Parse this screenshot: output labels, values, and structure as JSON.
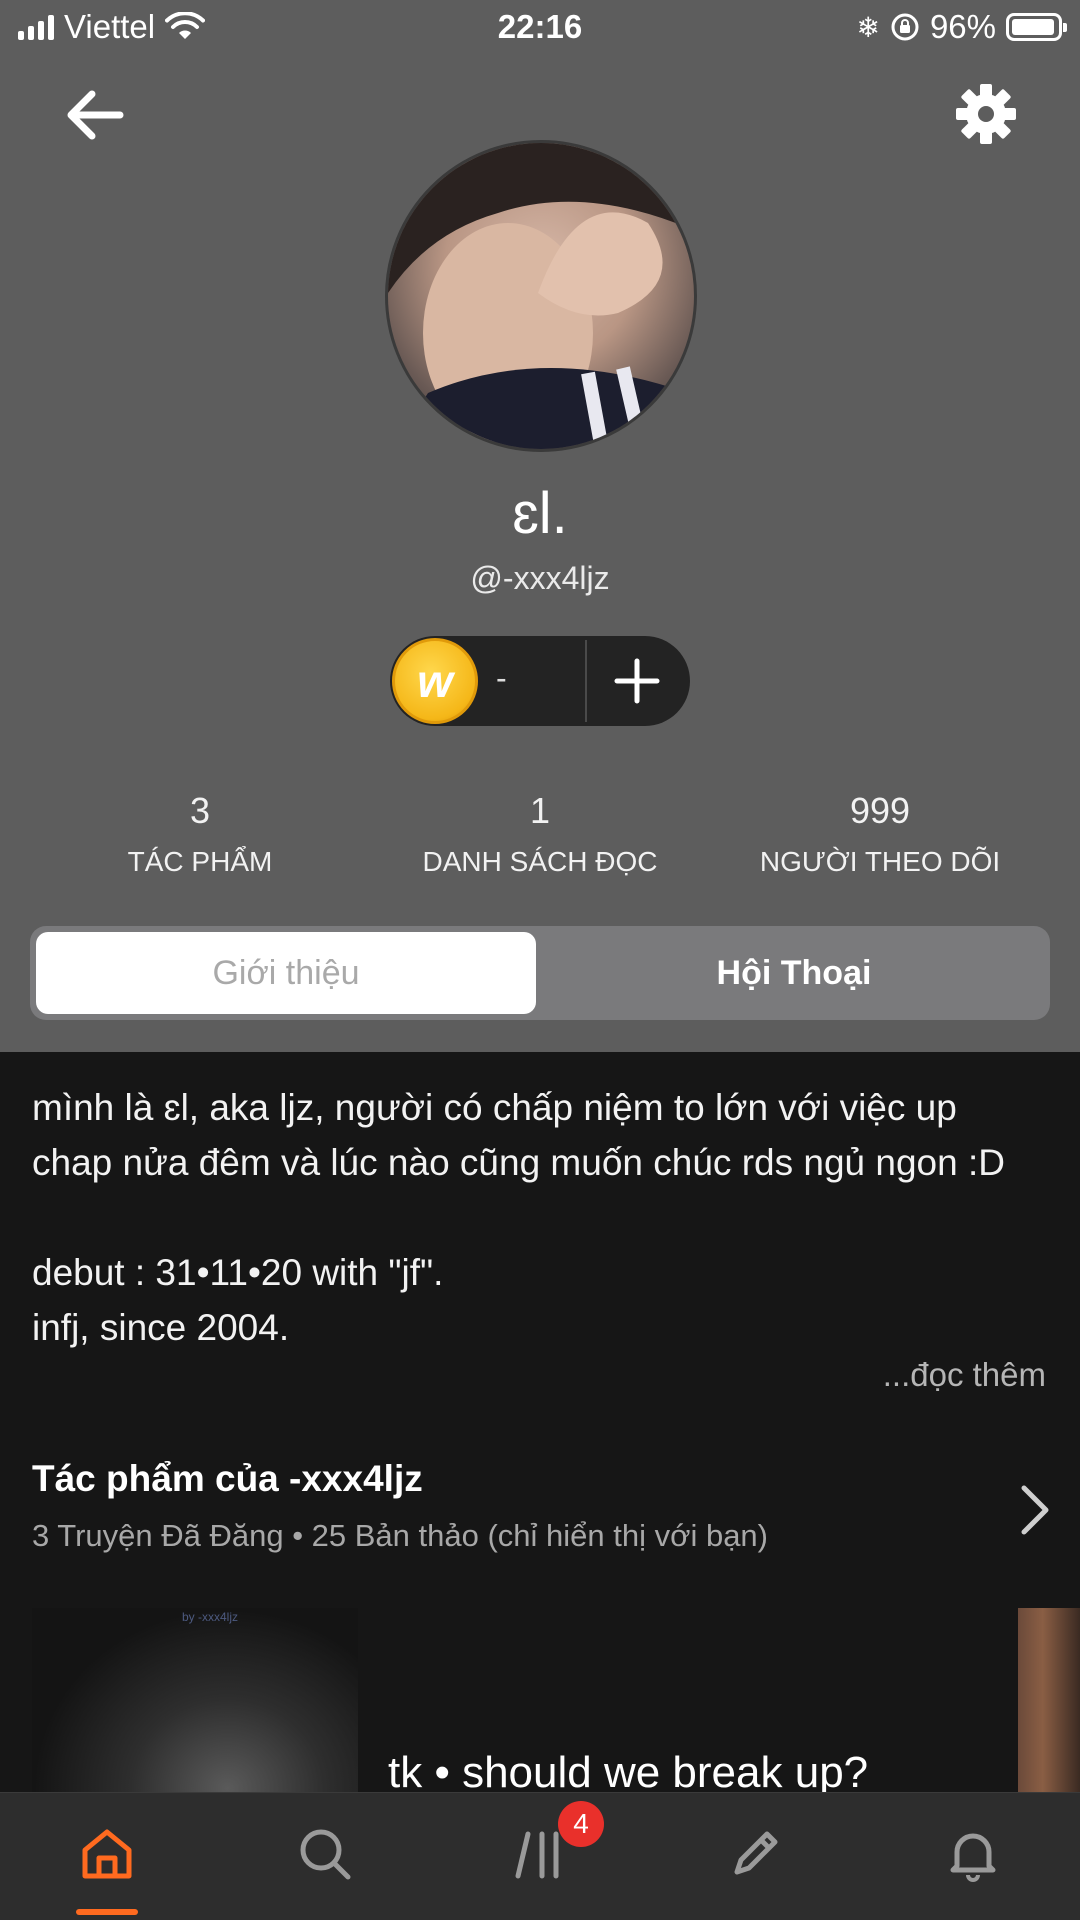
{
  "status_bar": {
    "carrier": "Viettel",
    "time": "22:16",
    "battery": "96%",
    "battery_level": 0.96
  },
  "profile": {
    "display_name": "ɛl.",
    "username": "@-xxx4ljz",
    "coins": "-"
  },
  "stats": [
    {
      "value": "3",
      "label": "TÁC PHẨM"
    },
    {
      "value": "1",
      "label": "DANH SÁCH ĐỌC"
    },
    {
      "value": "999",
      "label": "NGƯỜI THEO DÕI"
    }
  ],
  "tabs": {
    "about": "Giới thiệu",
    "conversations": "Hội Thoại",
    "active": "about"
  },
  "about": {
    "text": "mình là ɛl, aka ljz, người có chấp niệm to lớn với việc up\nchap nửa đêm và lúc nào cũng muốn chúc rds ngủ ngon :D\n\ndebut : 31•11•20 with \"jf\".\ninfj, since 2004.",
    "read_more": "...đọc thêm"
  },
  "works": {
    "title": "Tác phẩm của -xxx4ljz",
    "subtitle": "3 Truyện Đã Đăng • 25 Bản thảo (chỉ hiển thị với bạn)",
    "first_story_title": "tk • should we break up?",
    "cover_watermark": "by -xxx4ljz"
  },
  "bottom_nav": {
    "active": "home",
    "library_badge": "4"
  },
  "colors": {
    "header_bg": "#5d5d5d",
    "body_bg": "#161616",
    "accent": "#ff6a1f",
    "badge": "#e9302b",
    "coin": "#f5b718"
  },
  "icons": [
    "back-arrow-icon",
    "gear-icon",
    "coin-icon",
    "plus-icon",
    "chevron-right-icon",
    "home-icon",
    "search-icon",
    "library-icon",
    "pencil-icon",
    "bell-icon"
  ]
}
